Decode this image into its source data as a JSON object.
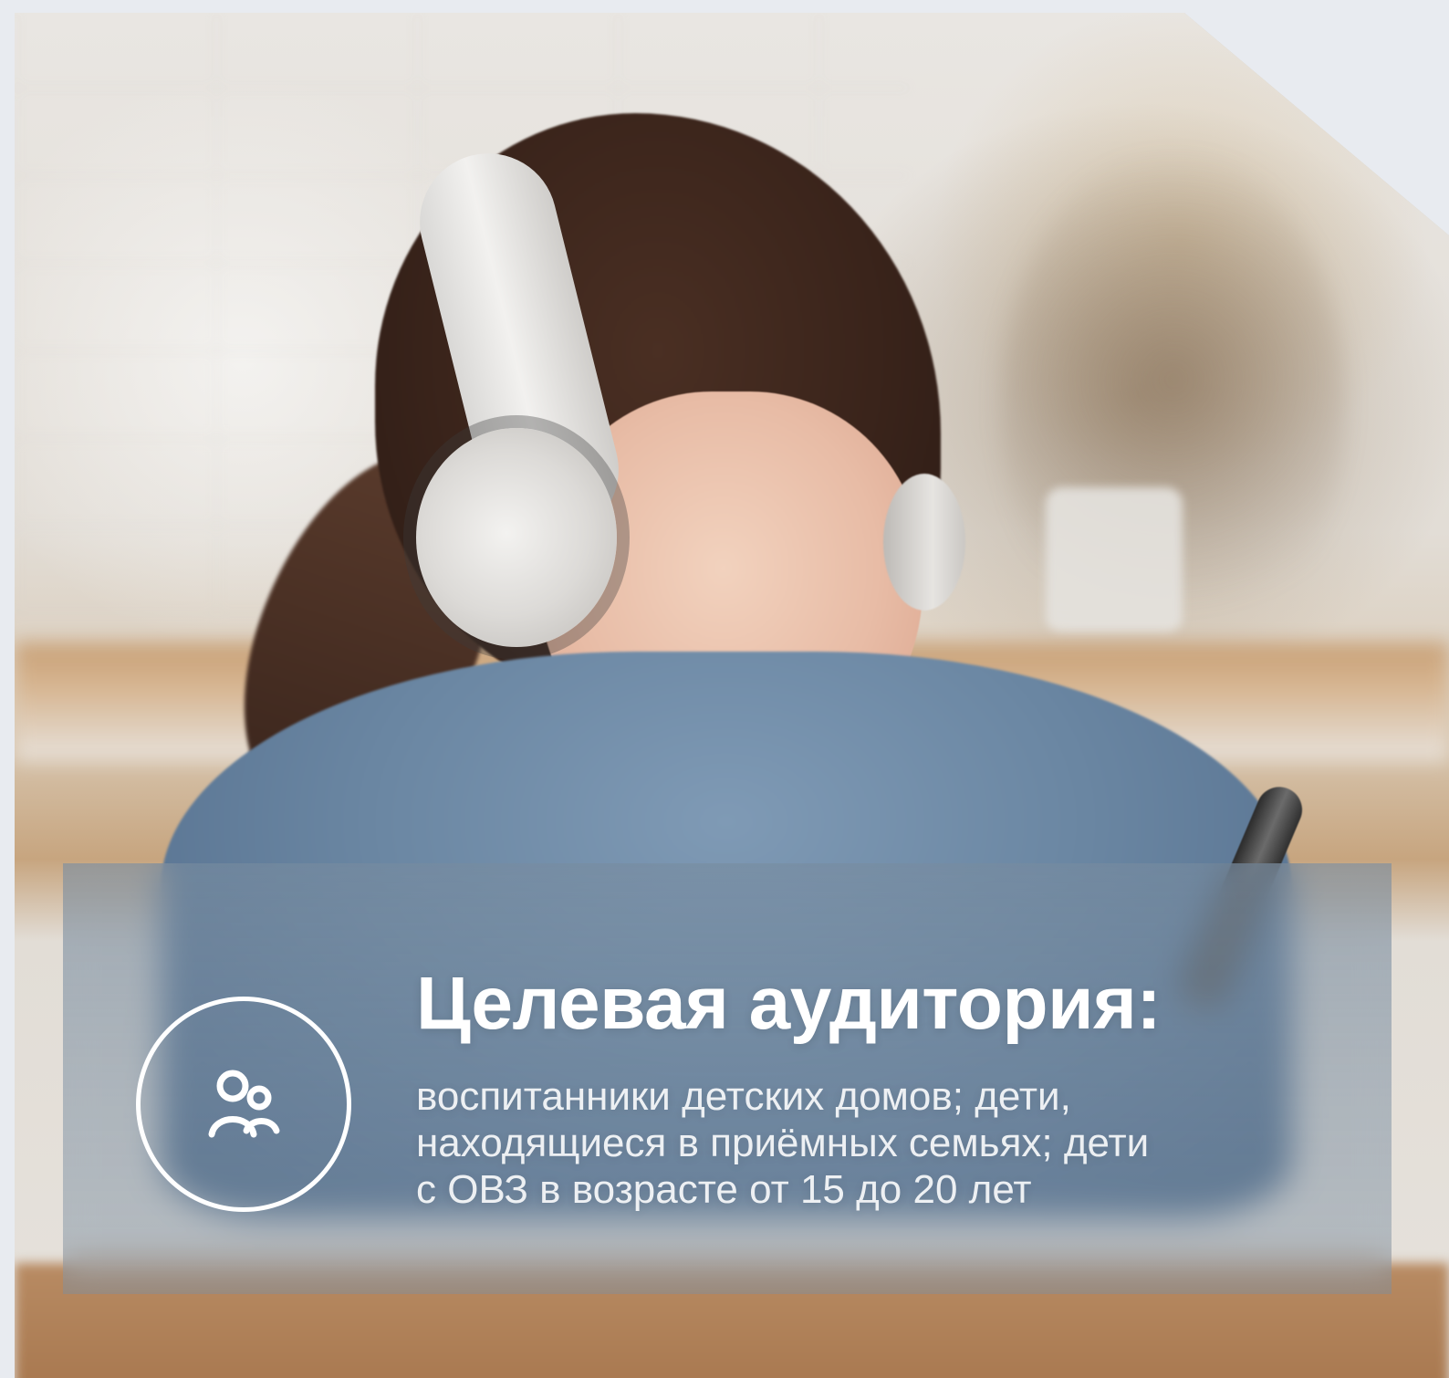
{
  "colors": {
    "page_background": "#e8ebf0",
    "overlay_panel": "rgba(120,140,160,0.55)",
    "title_text": "#ffffff",
    "description_text": "rgba(255,255,255,0.88)",
    "icon_stroke": "#ffffff"
  },
  "overlay": {
    "title": "Целевая аудитория:",
    "description_lines": [
      "воспитанники детских домов; дети,",
      "находящиеся в приёмных семьях; дети",
      "с ОВЗ в возрасте от 15 до 20 лет"
    ],
    "icon": "people-icon"
  }
}
